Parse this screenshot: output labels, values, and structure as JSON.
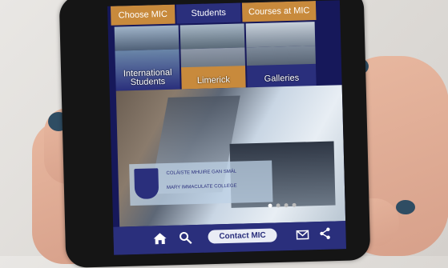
{
  "top_tabs": [
    "Choose MIC",
    "Students",
    "Courses at MIC"
  ],
  "tiles": [
    {
      "label": "International Students"
    },
    {
      "label": "Limerick"
    },
    {
      "label": "Galleries"
    }
  ],
  "banner": {
    "line1": "COLÁISTE MHUIRE GAN SMÁL",
    "line2": "MARY IMMACULATE COLLEGE"
  },
  "nav": {
    "home_icon": "home-icon",
    "search_icon": "search-icon",
    "contact_label": "Contact MIC",
    "mail_icon": "mail-icon",
    "share_icon": "share-icon"
  },
  "carousel": {
    "total": 4,
    "active": 1
  },
  "colors": {
    "navy": "#2a2f7c",
    "orange": "#c88a3c",
    "background": "#16185a"
  }
}
